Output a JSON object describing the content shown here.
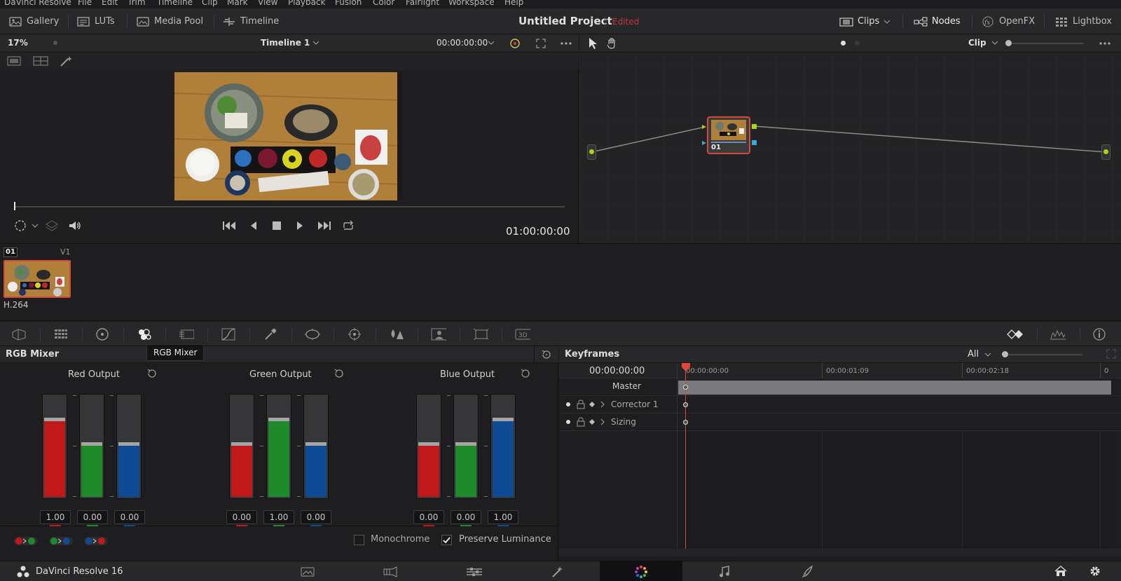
{
  "menu": [
    "DaVinci Resolve",
    "File",
    "Edit",
    "Trim",
    "Timeline",
    "Clip",
    "Mark",
    "View",
    "Playback",
    "Fusion",
    "Color",
    "Fairlight",
    "Workspace",
    "Help"
  ],
  "toolbar": {
    "gallery": "Gallery",
    "luts": "LUTs",
    "media_pool": "Media Pool",
    "timeline": "Timeline",
    "project_title": "Untitled Project",
    "project_status": "Edited",
    "clips": "Clips",
    "nodes": "Nodes",
    "openfx": "OpenFX",
    "lightbox": "Lightbox"
  },
  "viewer": {
    "zoom": "17%",
    "timeline_name": "Timeline 1",
    "timecode_top": "00:00:00:00",
    "timecode": "01:00:00:00"
  },
  "nodes_panel": {
    "mode": "Clip",
    "node_label": "01"
  },
  "clip_strip": {
    "clip_number": "01",
    "track": "V1",
    "codec": "H.264"
  },
  "mixer": {
    "title": "RGB Mixer",
    "tooltip": "RGB Mixer",
    "outputs": [
      {
        "label": "Red Output",
        "values": [
          "1.00",
          "0.00",
          "0.00"
        ],
        "levels": [
          1.0,
          0.0,
          0.0
        ]
      },
      {
        "label": "Green Output",
        "values": [
          "0.00",
          "1.00",
          "0.00"
        ],
        "levels": [
          0.0,
          1.0,
          0.0
        ]
      },
      {
        "label": "Blue Output",
        "values": [
          "0.00",
          "0.00",
          "1.00"
        ],
        "levels": [
          0.0,
          0.0,
          1.0
        ]
      }
    ],
    "monochrome": "Monochrome",
    "monochrome_checked": false,
    "preserve_luminance": "Preserve Luminance",
    "preserve_luminance_checked": true,
    "colors": {
      "red": "#c0191c",
      "green": "#1f8a2a",
      "blue": "#0f4a94"
    }
  },
  "keyframes": {
    "title": "Keyframes",
    "filter": "All",
    "current_tc": "00:00:00:00",
    "ruler": [
      "00:00:00:00",
      "00:00:01:09",
      "00:00:02:18",
      "0"
    ],
    "tracks": [
      "Master",
      "Corrector 1",
      "Sizing"
    ]
  },
  "pagebar": {
    "app_name": "DaVinci Resolve 16",
    "pages": [
      "media-page-icon",
      "cut-page-icon",
      "edit-page-icon",
      "fusion-page-icon",
      "color-page-icon",
      "fairlight-page-icon",
      "deliver-page-icon"
    ],
    "active_page": "color-page-icon"
  }
}
